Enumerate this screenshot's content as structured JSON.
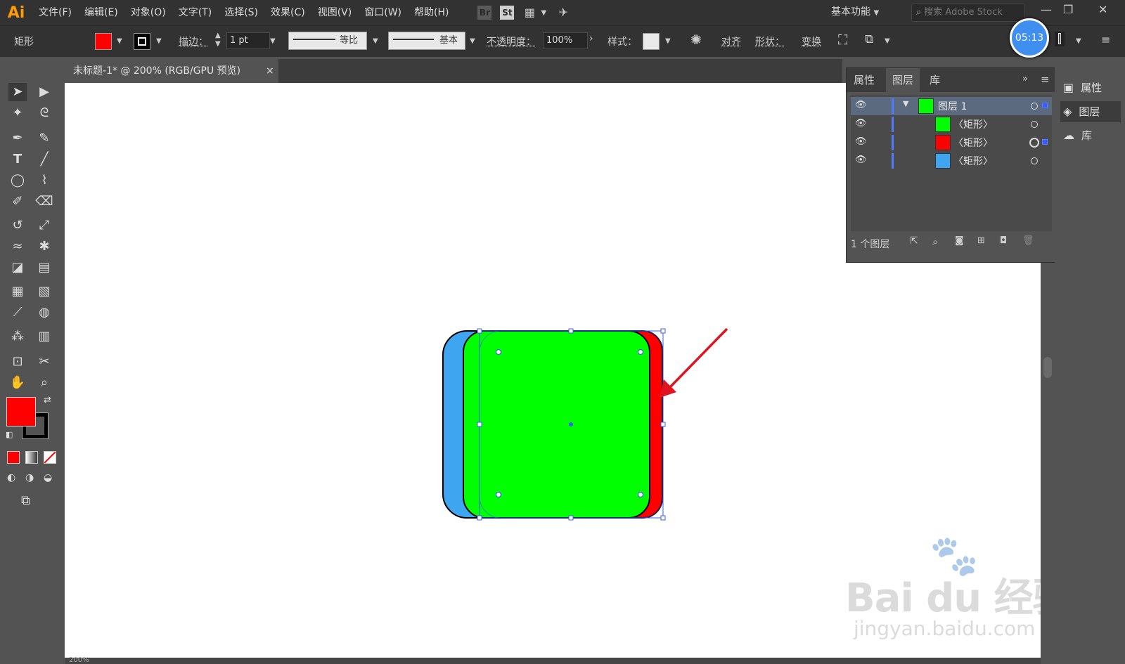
{
  "app": {
    "logo": "Ai"
  },
  "menu": [
    "文件(F)",
    "编辑(E)",
    "对象(O)",
    "文字(T)",
    "选择(S)",
    "效果(C)",
    "视图(V)",
    "窗口(W)",
    "帮助(H)"
  ],
  "menu_icons": {
    "br": "Br",
    "st": "St"
  },
  "workspace": {
    "label": "基本功能"
  },
  "stock_search": {
    "placeholder": "搜索 Adobe Stock"
  },
  "control_bar": {
    "object_type": "矩形",
    "fill_color": "#ff0000",
    "stroke_label": "描边：",
    "stroke_weight": "1 pt",
    "profile_label": "等比",
    "brush_label": "基本",
    "opacity_label": "不透明度：",
    "opacity_value": "100%",
    "style_label": "样式：",
    "align_label": "对齐",
    "shape_label": "形状：",
    "transform_label": "变换"
  },
  "timer": "05:13",
  "document_tab": {
    "title": "未标题-1* @ 200% (RGB/GPU 预览)",
    "close": "×"
  },
  "tools": {
    "fill_color": "#ff0000",
    "stroke_color": "#000000"
  },
  "artwork": {
    "colors": {
      "blue": "#3ea6f0",
      "green": "#00ff00",
      "red": "#ff0000",
      "selection": "#3d5cff",
      "arrow": "#e0141e"
    }
  },
  "layers_panel": {
    "tabs": [
      "属性",
      "图层",
      "库"
    ],
    "active_tab": "图层",
    "layer_name": "图层 1",
    "layer_color": "#00ff00",
    "items": [
      {
        "name": "〈矩形〉",
        "color": "#00ff00"
      },
      {
        "name": "〈矩形〉",
        "color": "#ff0000"
      },
      {
        "name": "〈矩形〉",
        "color": "#3ea6f0"
      }
    ],
    "footer_count": "1 个图层"
  },
  "dock": {
    "items": [
      "属性",
      "图层",
      "库"
    ]
  },
  "watermark": {
    "brand": "Bai du 经验",
    "url": "jingyan.baidu.com"
  },
  "status_bar": {
    "zoom": "200%"
  }
}
